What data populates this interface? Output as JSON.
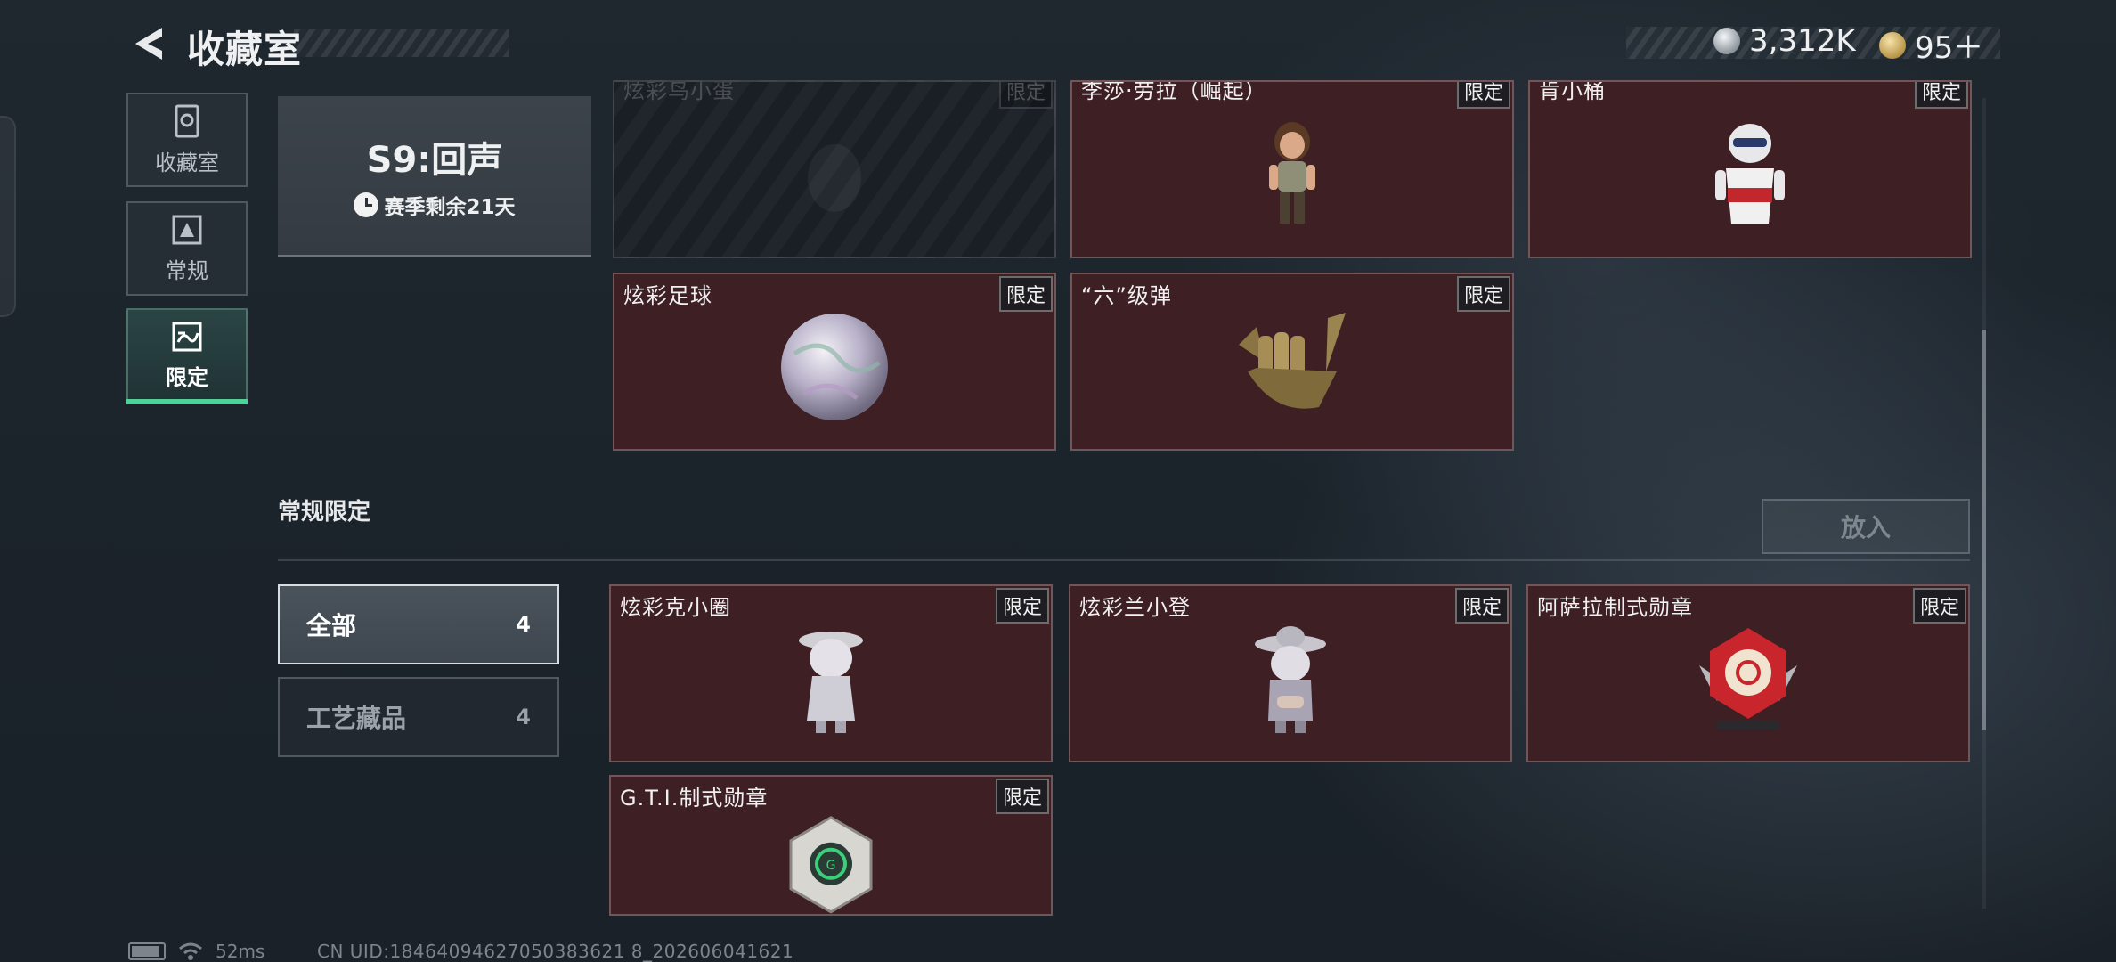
{
  "header": {
    "title": "收藏室",
    "currency_1": "3,312K",
    "currency_1_icon": "silver-coin-icon",
    "currency_2": "95＋",
    "currency_2_icon": "gold-coin-icon"
  },
  "nav": {
    "items": [
      {
        "label": "收藏室",
        "icon": "collection-icon"
      },
      {
        "label": "常规",
        "icon": "regular-icon"
      },
      {
        "label": "限定",
        "icon": "limited-icon",
        "active": true
      }
    ]
  },
  "season": {
    "title": "S9:回声",
    "remaining": "赛季剩余21天"
  },
  "season_items": [
    {
      "name": "炫彩鸟小蛋",
      "badge": "限定",
      "locked": true
    },
    {
      "name": "李莎·劳拉（崛起）",
      "badge": "限定"
    },
    {
      "name": "肯小桶",
      "badge": "限定"
    },
    {
      "name": "炫彩足球",
      "badge": "限定"
    },
    {
      "name": "“六”级弹",
      "badge": "限定"
    }
  ],
  "regular_section": {
    "title": "常规限定",
    "put_button": "放入",
    "filters": [
      {
        "label": "全部",
        "count": "4",
        "active": true
      },
      {
        "label": "工艺藏品",
        "count": "4"
      }
    ],
    "items": [
      {
        "name": "炫彩克小圈",
        "badge": "限定"
      },
      {
        "name": "炫彩兰小登",
        "badge": "限定"
      },
      {
        "name": "阿萨拉制式勋章",
        "badge": "限定"
      },
      {
        "name": "G.T.I.制式勋章",
        "badge": "限定"
      }
    ]
  },
  "status_bar": {
    "ping": "52ms",
    "uid": "CN UID:18464094627050383621 8_202606041621"
  },
  "colors": {
    "accent": "#4fd19a",
    "card_bg": "#3d1f24",
    "background": "#1d252d"
  }
}
